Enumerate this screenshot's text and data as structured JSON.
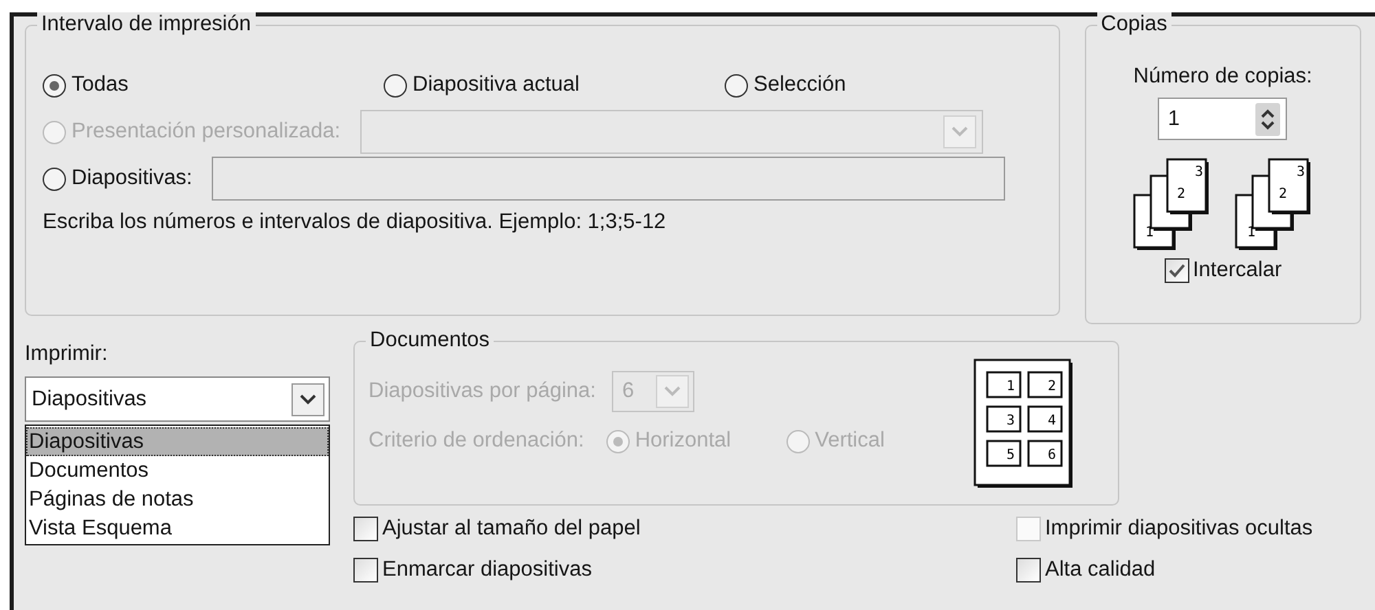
{
  "print_range": {
    "title": "Intervalo de impresión",
    "options": [
      {
        "label": "Todas",
        "selected": true,
        "disabled": false
      },
      {
        "label": "Diapositiva actual",
        "selected": false,
        "disabled": false
      },
      {
        "label": "Selección",
        "selected": false,
        "disabled": false
      }
    ],
    "custom_show": {
      "label": "Presentación personalizada:",
      "selected": false,
      "disabled": true
    },
    "slides": {
      "label": "Diapositivas:",
      "selected": false,
      "disabled": false
    },
    "hint": "Escriba los números e intervalos de diapositiva. Ejemplo: 1;3;5-12"
  },
  "copies": {
    "title": "Copias",
    "label": "Número de copias:",
    "value": "1",
    "collate_icons": [
      {
        "pages": [
          "1",
          "2",
          "3"
        ]
      },
      {
        "pages": [
          "1",
          "2",
          "3"
        ]
      }
    ],
    "collate": {
      "label": "Intercalar",
      "checked": true,
      "disabled": false
    }
  },
  "print_what": {
    "label": "Imprimir:",
    "value": "Diapositivas",
    "options": [
      {
        "label": "Diapositivas",
        "selected": true
      },
      {
        "label": "Documentos",
        "selected": false
      },
      {
        "label": "Páginas de notas",
        "selected": false
      },
      {
        "label": "Vista Esquema",
        "selected": false
      }
    ]
  },
  "handouts": {
    "title": "Documentos",
    "disabled": true,
    "per_page_label": "Diapositivas por página:",
    "per_page_value": "6",
    "order_label": "Criterio de ordenación:",
    "order": [
      {
        "label": "Horizontal",
        "selected": true
      },
      {
        "label": "Vertical",
        "selected": false
      }
    ],
    "preview": [
      "1",
      "2",
      "3",
      "4",
      "5",
      "6"
    ]
  },
  "checkboxes": [
    {
      "label": "Ajustar al tamaño del papel",
      "checked": false,
      "disabled": false
    },
    {
      "label": "Imprimir diapositivas ocultas",
      "checked": false,
      "disabled": true
    },
    {
      "label": "Enmarcar diapositivas",
      "checked": false,
      "disabled": false
    },
    {
      "label": "Alta calidad",
      "checked": false,
      "disabled": false
    }
  ]
}
